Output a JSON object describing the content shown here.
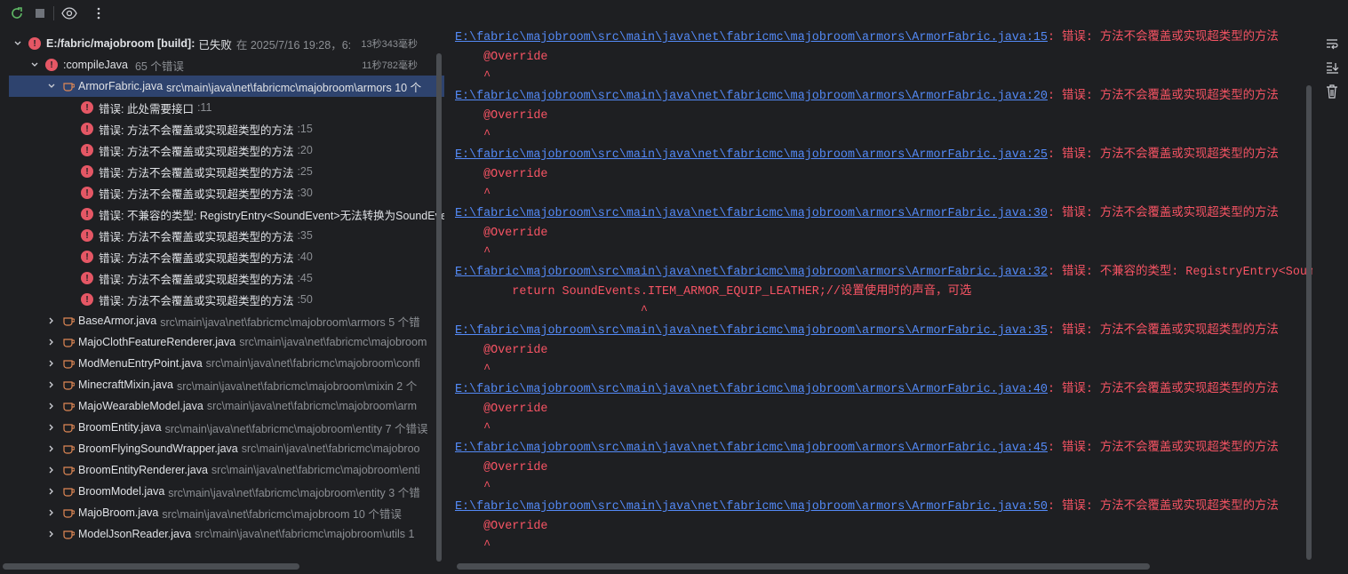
{
  "toolbar": {
    "icons": [
      "rerun-icon",
      "stop-icon",
      "eye-icon",
      "more-icon"
    ]
  },
  "tree": {
    "root": {
      "title": "E:/fabric/majobroom [build]:",
      "status": "已失败",
      "when": "在 2025/7/16 19:28，6:",
      "time": "13秒343毫秒"
    },
    "task": {
      "title": ":compileJava",
      "count": "65 个错误",
      "time": "11秒782毫秒"
    },
    "selected_file": {
      "name": "ArmorFabric.java",
      "path": "src\\main\\java\\net\\fabricmc\\majobroom\\armors 10 个"
    },
    "errors": [
      {
        "text": "错误: 此处需要接口",
        "line": ":11"
      },
      {
        "text": "错误: 方法不会覆盖或实现超类型的方法",
        "line": ":15"
      },
      {
        "text": "错误: 方法不会覆盖或实现超类型的方法",
        "line": ":20"
      },
      {
        "text": "错误: 方法不会覆盖或实现超类型的方法",
        "line": ":25"
      },
      {
        "text": "错误: 方法不会覆盖或实现超类型的方法",
        "line": ":30"
      },
      {
        "text": "错误: 不兼容的类型: RegistryEntry<SoundEvent>无法转换为SoundEven",
        "line": ""
      },
      {
        "text": "错误: 方法不会覆盖或实现超类型的方法",
        "line": ":35"
      },
      {
        "text": "错误: 方法不会覆盖或实现超类型的方法",
        "line": ":40"
      },
      {
        "text": "错误: 方法不会覆盖或实现超类型的方法",
        "line": ":45"
      },
      {
        "text": "错误: 方法不会覆盖或实现超类型的方法",
        "line": ":50"
      }
    ],
    "files": [
      {
        "name": "BaseArmor.java",
        "path": "src\\main\\java\\net\\fabricmc\\majobroom\\armors 5 个错"
      },
      {
        "name": "MajoClothFeatureRenderer.java",
        "path": "src\\main\\java\\net\\fabricmc\\majobroom"
      },
      {
        "name": "ModMenuEntryPoint.java",
        "path": "src\\main\\java\\net\\fabricmc\\majobroom\\confi"
      },
      {
        "name": "MinecraftMixin.java",
        "path": "src\\main\\java\\net\\fabricmc\\majobroom\\mixin 2 个"
      },
      {
        "name": "MajoWearableModel.java",
        "path": "src\\main\\java\\net\\fabricmc\\majobroom\\arm"
      },
      {
        "name": "BroomEntity.java",
        "path": "src\\main\\java\\net\\fabricmc\\majobroom\\entity 7 个错误"
      },
      {
        "name": "BroomFlyingSoundWrapper.java",
        "path": "src\\main\\java\\net\\fabricmc\\majobroo"
      },
      {
        "name": "BroomEntityRenderer.java",
        "path": "src\\main\\java\\net\\fabricmc\\majobroom\\enti"
      },
      {
        "name": "BroomModel.java",
        "path": "src\\main\\java\\net\\fabricmc\\majobroom\\entity 3 个错"
      },
      {
        "name": "MajoBroom.java",
        "path": "src\\main\\java\\net\\fabricmc\\majobroom 10 个错误"
      },
      {
        "name": "ModelJsonReader.java",
        "path": "src\\main\\java\\net\\fabricmc\\majobroom\\utils 1"
      }
    ]
  },
  "console": {
    "lines": [
      {
        "kind": "link",
        "link": "E:\\fabric\\majobroom\\src\\main\\java\\net\\fabricmc\\majobroom\\armors\\ArmorFabric.java:15",
        "msg": ": 错误: 方法不会覆盖或实现超类型的方法"
      },
      {
        "kind": "code",
        "text": "    @Override"
      },
      {
        "kind": "code",
        "text": "    ^"
      },
      {
        "kind": "link",
        "link": "E:\\fabric\\majobroom\\src\\main\\java\\net\\fabricmc\\majobroom\\armors\\ArmorFabric.java:20",
        "msg": ": 错误: 方法不会覆盖或实现超类型的方法"
      },
      {
        "kind": "code",
        "text": "    @Override"
      },
      {
        "kind": "code",
        "text": "    ^"
      },
      {
        "kind": "link",
        "link": "E:\\fabric\\majobroom\\src\\main\\java\\net\\fabricmc\\majobroom\\armors\\ArmorFabric.java:25",
        "msg": ": 错误: 方法不会覆盖或实现超类型的方法"
      },
      {
        "kind": "code",
        "text": "    @Override"
      },
      {
        "kind": "code",
        "text": "    ^"
      },
      {
        "kind": "link",
        "link": "E:\\fabric\\majobroom\\src\\main\\java\\net\\fabricmc\\majobroom\\armors\\ArmorFabric.java:30",
        "msg": ": 错误: 方法不会覆盖或实现超类型的方法"
      },
      {
        "kind": "code",
        "text": "    @Override"
      },
      {
        "kind": "code",
        "text": "    ^"
      },
      {
        "kind": "link",
        "link": "E:\\fabric\\majobroom\\src\\main\\java\\net\\fabricmc\\majobroom\\armors\\ArmorFabric.java:32",
        "msg": ": 错误: 不兼容的类型: RegistryEntry<Sound"
      },
      {
        "kind": "code",
        "text": "        return SoundEvents.ITEM_ARMOR_EQUIP_LEATHER;//设置使用时的声音，可选"
      },
      {
        "kind": "code",
        "text": "                          ^"
      },
      {
        "kind": "link",
        "link": "E:\\fabric\\majobroom\\src\\main\\java\\net\\fabricmc\\majobroom\\armors\\ArmorFabric.java:35",
        "msg": ": 错误: 方法不会覆盖或实现超类型的方法"
      },
      {
        "kind": "code",
        "text": "    @Override"
      },
      {
        "kind": "code",
        "text": "    ^"
      },
      {
        "kind": "link",
        "link": "E:\\fabric\\majobroom\\src\\main\\java\\net\\fabricmc\\majobroom\\armors\\ArmorFabric.java:40",
        "msg": ": 错误: 方法不会覆盖或实现超类型的方法"
      },
      {
        "kind": "code",
        "text": "    @Override"
      },
      {
        "kind": "code",
        "text": "    ^"
      },
      {
        "kind": "link",
        "link": "E:\\fabric\\majobroom\\src\\main\\java\\net\\fabricmc\\majobroom\\armors\\ArmorFabric.java:45",
        "msg": ": 错误: 方法不会覆盖或实现超类型的方法"
      },
      {
        "kind": "code",
        "text": "    @Override"
      },
      {
        "kind": "code",
        "text": "    ^"
      },
      {
        "kind": "link",
        "link": "E:\\fabric\\majobroom\\src\\main\\java\\net\\fabricmc\\majobroom\\armors\\ArmorFabric.java:50",
        "msg": ": 错误: 方法不会覆盖或实现超类型的方法"
      },
      {
        "kind": "code",
        "text": "    @Override"
      },
      {
        "kind": "code",
        "text": "    ^"
      }
    ]
  },
  "side_toolbar": {
    "icons": [
      "soft-wrap-icon",
      "scroll-to-end-icon",
      "trash-icon"
    ]
  },
  "colors": {
    "error": "#e55765",
    "link": "#548af7",
    "selection": "#2e436e",
    "console_error": "#f75464"
  }
}
